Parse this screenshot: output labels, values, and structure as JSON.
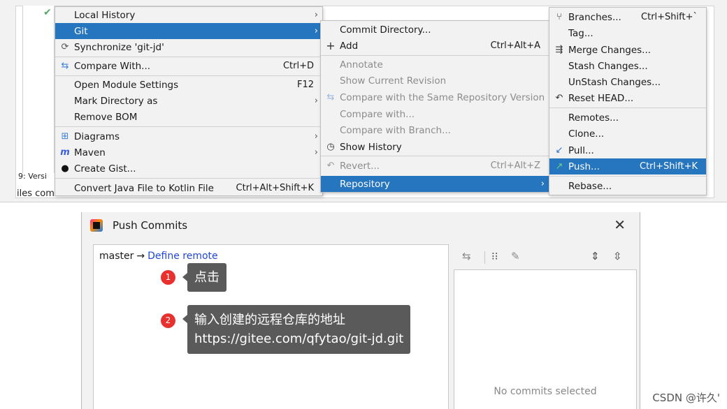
{
  "ide": {
    "left_label": "9: Versi",
    "left_label2": "iles com"
  },
  "menu1": {
    "items": [
      {
        "label": "Local History",
        "submenu": true
      },
      {
        "label": "Git",
        "submenu": true,
        "selected": true
      },
      {
        "label": "Synchronize 'git-jd'",
        "icon": "sync-icon"
      },
      {
        "label": "Compare With...",
        "shortcut": "Ctrl+D",
        "icon": "compare-icon"
      },
      {
        "label": "Open Module Settings",
        "shortcut": "F12"
      },
      {
        "label": "Mark Directory as",
        "submenu": true
      },
      {
        "label": "Remove BOM"
      },
      {
        "label": "Diagrams",
        "submenu": true,
        "icon": "diagram-icon"
      },
      {
        "label": "Maven",
        "submenu": true,
        "icon": "maven-icon"
      },
      {
        "label": "Create Gist...",
        "icon": "github-icon"
      },
      {
        "label": "Convert Java File to Kotlin File",
        "shortcut": "Ctrl+Alt+Shift+K"
      }
    ]
  },
  "menu2": {
    "items": [
      {
        "label": "Commit Directory..."
      },
      {
        "label": "Add",
        "shortcut": "Ctrl+Alt+A",
        "icon": "plus-icon"
      },
      {
        "label": "Annotate",
        "disabled": true
      },
      {
        "label": "Show Current Revision",
        "disabled": true
      },
      {
        "label": "Compare with the Same Repository Version",
        "disabled": true,
        "icon": "compare-icon"
      },
      {
        "label": "Compare with...",
        "disabled": true
      },
      {
        "label": "Compare with Branch...",
        "disabled": true
      },
      {
        "label": "Show History",
        "icon": "clock-icon"
      },
      {
        "label": "Revert...",
        "shortcut": "Ctrl+Alt+Z",
        "disabled": true,
        "icon": "revert-icon"
      },
      {
        "label": "Repository",
        "submenu": true,
        "selected": true
      }
    ]
  },
  "menu3": {
    "items": [
      {
        "label": "Branches...",
        "shortcut": "Ctrl+Shift+`",
        "icon": "branch-icon"
      },
      {
        "label": "Tag..."
      },
      {
        "label": "Merge Changes...",
        "icon": "merge-icon"
      },
      {
        "label": "Stash Changes..."
      },
      {
        "label": "UnStash Changes..."
      },
      {
        "label": "Reset HEAD...",
        "icon": "reset-icon"
      },
      {
        "label": "Remotes..."
      },
      {
        "label": "Clone..."
      },
      {
        "label": "Pull...",
        "icon": "pull-icon"
      },
      {
        "label": "Push...",
        "shortcut": "Ctrl+Shift+K",
        "selected": true,
        "icon": "push-icon"
      },
      {
        "label": "Rebase..."
      }
    ]
  },
  "dialog": {
    "title": "Push Commits",
    "branch": "master",
    "arrow": "→",
    "define_remote": "Define remote",
    "no_commits": "No commits selected"
  },
  "annotations": [
    {
      "number": "1",
      "lines": [
        "点击"
      ]
    },
    {
      "number": "2",
      "lines": [
        "输入创建的远程仓库的地址",
        "https://gitee.com/qfytao/git-jd.git"
      ]
    }
  ],
  "watermark": "CSDN @许久'",
  "colors": {
    "selection": "#2675bf",
    "link": "#2246d8",
    "badge": "#e8302e",
    "bubble": "#5a5a5a"
  }
}
